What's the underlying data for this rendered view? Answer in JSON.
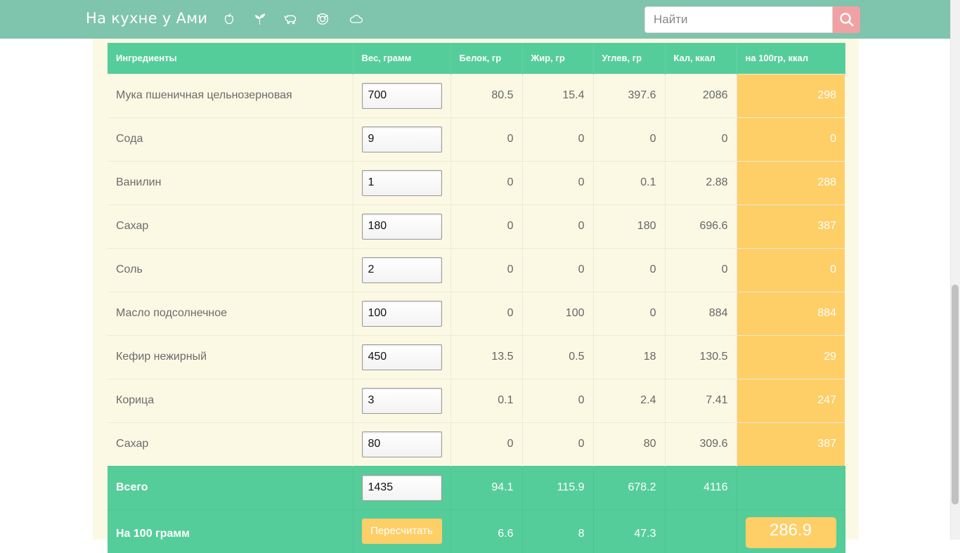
{
  "header": {
    "brand": "На кухне у Ами",
    "icons": [
      "apple-icon",
      "sprout-icon",
      "cow-icon",
      "plate-icon",
      "cloud-icon"
    ],
    "search_placeholder": "Найти",
    "search_icon": "search-icon",
    "bg_color": "#7fc4ac",
    "search_btn_color": "#f0a1a3"
  },
  "table": {
    "headers": [
      "Ингредиенты",
      "Вес, грамм",
      "Белок, гр",
      "Жир, гр",
      "Углев, гр",
      "Кал, ккал",
      "на 100гр, ккал"
    ],
    "rows": [
      {
        "name": "Мука пшеничная цельнозерновая",
        "weight": "700",
        "protein": "80.5",
        "fat": "15.4",
        "carbs": "397.6",
        "kcal": "2086",
        "per100": "298"
      },
      {
        "name": "Сода",
        "weight": "9",
        "protein": "0",
        "fat": "0",
        "carbs": "0",
        "kcal": "0",
        "per100": "0"
      },
      {
        "name": "Ванилин",
        "weight": "1",
        "protein": "0",
        "fat": "0",
        "carbs": "0.1",
        "kcal": "2.88",
        "per100": "288"
      },
      {
        "name": "Сахар",
        "weight": "180",
        "protein": "0",
        "fat": "0",
        "carbs": "180",
        "kcal": "696.6",
        "per100": "387"
      },
      {
        "name": "Соль",
        "weight": "2",
        "protein": "0",
        "fat": "0",
        "carbs": "0",
        "kcal": "0",
        "per100": "0"
      },
      {
        "name": "Масло подсолнечное",
        "weight": "100",
        "protein": "0",
        "fat": "100",
        "carbs": "0",
        "kcal": "884",
        "per100": "884"
      },
      {
        "name": "Кефир нежирный",
        "weight": "450",
        "protein": "13.5",
        "fat": "0.5",
        "carbs": "18",
        "kcal": "130.5",
        "per100": "29"
      },
      {
        "name": "Корица",
        "weight": "3",
        "protein": "0.1",
        "fat": "0",
        "carbs": "2.4",
        "kcal": "7.41",
        "per100": "247"
      },
      {
        "name": "Сахар",
        "weight": "80",
        "protein": "0",
        "fat": "0",
        "carbs": "80",
        "kcal": "309.6",
        "per100": "387"
      }
    ],
    "total": {
      "label": "Всего",
      "weight": "1435",
      "protein": "94.1",
      "fat": "115.9",
      "carbs": "678.2",
      "kcal": "4116"
    },
    "per100row": {
      "label": "На 100 грамм",
      "button": "Пересчитать",
      "protein": "6.6",
      "fat": "8",
      "carbs": "47.3",
      "result": "286.9"
    },
    "colors": {
      "header": "#55cd9a",
      "highlight": "#fece67",
      "panel": "#fbf9e4"
    }
  }
}
